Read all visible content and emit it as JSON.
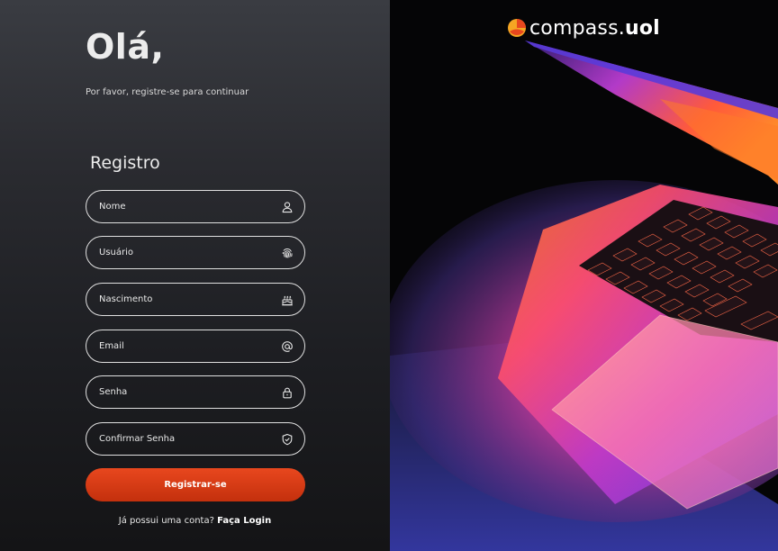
{
  "header": {
    "greeting": "Olá,",
    "subtitle": "Por favor, registre-se para continuar"
  },
  "form": {
    "title": "Registro",
    "fields": [
      {
        "label": "Nome",
        "icon": "user-icon"
      },
      {
        "label": "Usuário",
        "icon": "fingerprint-icon"
      },
      {
        "label": "Nascimento",
        "icon": "cake-icon"
      },
      {
        "label": "Email",
        "icon": "at-icon"
      },
      {
        "label": "Senha",
        "icon": "lock-icon"
      },
      {
        "label": "Confirmar Senha",
        "icon": "shield-check-icon"
      }
    ],
    "submit_label": "Registrar-se",
    "login_prompt": "Já possui uma conta?",
    "login_link": "Faça Login"
  },
  "brand": {
    "name_part1": "compass.",
    "name_part2": "uol",
    "logo_colors": [
      "#f5a623",
      "#e8471e"
    ]
  },
  "colors": {
    "accent": "#e8471e",
    "panel_top": "#3a3c42",
    "panel_bottom": "#141416"
  }
}
